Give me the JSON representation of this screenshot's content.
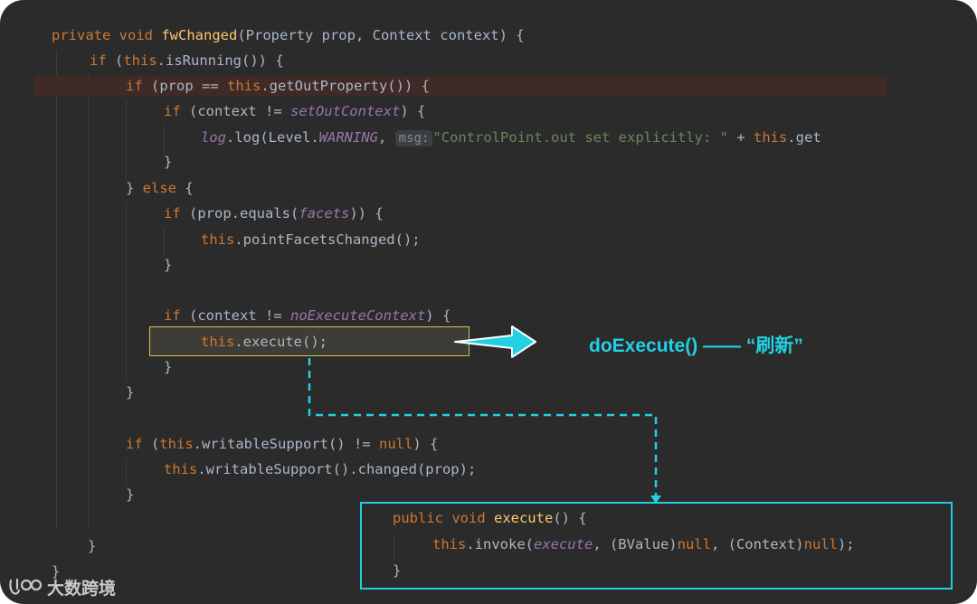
{
  "editor": {
    "line1": {
      "kw": "private void ",
      "fn": "fwChanged",
      "rest": "(Property prop, Context context) {"
    },
    "line2": {
      "kw": "if ",
      "a": "(",
      "kw2": "this",
      "b": ".isRunning()) {"
    },
    "line3": {
      "kw": "if ",
      "a": "(prop == ",
      "kw2": "this",
      "b": ".getOutProperty()) {"
    },
    "line4": {
      "kw": "if ",
      "a": "(context != ",
      "it": "setOutContext",
      "b": ") {"
    },
    "line5": {
      "it1": "log",
      "a": ".log(Level.",
      "it2": "WARNING",
      "b": ", ",
      "hint": "msg:",
      "str": "\"ControlPoint.out set explicitly: \"",
      "c": " + ",
      "kw": "this",
      "d": ".get"
    },
    "line6": "}",
    "line7": {
      "a": "} ",
      "kw": "else",
      "b": " {"
    },
    "line8": {
      "kw": "if ",
      "a": "(prop.equals(",
      "it": "facets",
      "b": ")) {"
    },
    "line9": {
      "kw": "this",
      "a": ".pointFacetsChanged();"
    },
    "line10": "}",
    "line11": {
      "kw": "if ",
      "a": "(context != ",
      "it": "noExecuteContext",
      "b": ") {"
    },
    "line12": {
      "kw": "this",
      "a": ".execute();"
    },
    "line13": "}",
    "line14": "}",
    "line15": {
      "kw": "if ",
      "a": "(",
      "kw2": "this",
      "b": ".writableSupport() != ",
      "kw3": "null",
      "c": ") {"
    },
    "line16": {
      "kw": "this",
      "a": ".writableSupport().changed(prop);"
    },
    "line17": "}",
    "line18": "}",
    "line19": "}"
  },
  "callout": {
    "line1": {
      "kw": "public void ",
      "fn": "execute",
      "rest": "() {"
    },
    "line2": {
      "kw": "this",
      "a": ".invoke(",
      "it": "execute",
      "b": ", (BValue)",
      "kw2": "null",
      "c": ", (Context)",
      "kw3": "null",
      "d": ");"
    },
    "line3": "}"
  },
  "annotation": "doExecute() —— “刷新”",
  "watermark": "大数跨境",
  "colors": {
    "annotation_accent": "#21d1e3",
    "box_highlight": "#d8c24a",
    "error_line": "#3f2a27",
    "background": "#2b2b2b"
  }
}
